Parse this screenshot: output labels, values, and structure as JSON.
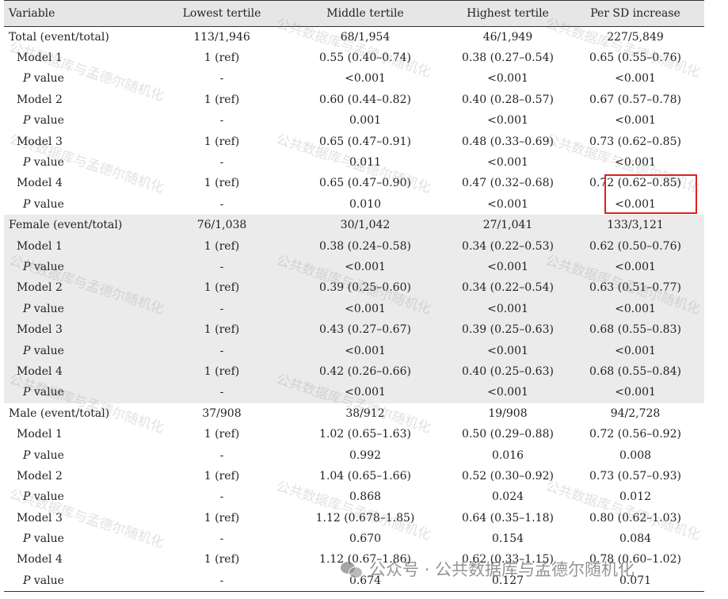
{
  "header": [
    "Variable",
    "Lowest tertile",
    "Middle tertile",
    "Highest tertile",
    "Per SD increase"
  ],
  "rows": [
    {
      "kind": "group",
      "shaded": false,
      "label": "Total (event/total)",
      "cells": [
        "113/1,946",
        "68/1,954",
        "46/1,949",
        "227/5,849"
      ]
    },
    {
      "kind": "model",
      "shaded": false,
      "label": "Model 1",
      "cells": [
        "1 (ref)",
        "0.55 (0.40–0.74)",
        "0.38 (0.27–0.54)",
        "0.65 (0.55–0.76)"
      ]
    },
    {
      "kind": "pval",
      "shaded": false,
      "p": "P",
      "label": " value",
      "cells": [
        "-",
        "<0.001",
        "<0.001",
        "<0.001"
      ]
    },
    {
      "kind": "model",
      "shaded": false,
      "label": "Model 2",
      "cells": [
        "1 (ref)",
        "0.60 (0.44–0.82)",
        "0.40 (0.28–0.57)",
        "0.67 (0.57–0.78)"
      ]
    },
    {
      "kind": "pval",
      "shaded": false,
      "p": "P",
      "label": " value",
      "cells": [
        "-",
        "0.001",
        "<0.001",
        "<0.001"
      ]
    },
    {
      "kind": "model",
      "shaded": false,
      "label": "Model 3",
      "cells": [
        "1 (ref)",
        "0.65 (0.47–0.91)",
        "0.48 (0.33–0.69)",
        "0.73 (0.62–0.85)"
      ]
    },
    {
      "kind": "pval",
      "shaded": false,
      "p": "P",
      "label": " value",
      "cells": [
        "-",
        "0.011",
        "<0.001",
        "<0.001"
      ]
    },
    {
      "kind": "model",
      "shaded": false,
      "label": "Model 4",
      "cells": [
        "1 (ref)",
        "0.65 (0.47–0.90)",
        "0.47 (0.32–0.68)",
        "0.72 (0.62–0.85)"
      ]
    },
    {
      "kind": "pval",
      "shaded": false,
      "p": "P",
      "label": " value",
      "cells": [
        "-",
        "0.010",
        "<0.001",
        "<0.001"
      ]
    },
    {
      "kind": "group",
      "shaded": true,
      "label": "Female (event/total)",
      "cells": [
        "76/1,038",
        "30/1,042",
        "27/1,041",
        "133/3,121"
      ]
    },
    {
      "kind": "model",
      "shaded": true,
      "label": "Model 1",
      "cells": [
        "1 (ref)",
        "0.38 (0.24–0.58)",
        "0.34 (0.22–0.53)",
        "0.62 (0.50–0.76)"
      ]
    },
    {
      "kind": "pval",
      "shaded": true,
      "p": "P",
      "label": " value",
      "cells": [
        "-",
        "<0.001",
        "<0.001",
        "<0.001"
      ]
    },
    {
      "kind": "model",
      "shaded": true,
      "label": "Model 2",
      "cells": [
        "1 (ref)",
        "0.39 (0.25–0.60)",
        "0.34 (0.22–0.54)",
        "0.63 (0.51–0.77)"
      ]
    },
    {
      "kind": "pval",
      "shaded": true,
      "p": "P",
      "label": " value",
      "cells": [
        "-",
        "<0.001",
        "<0.001",
        "<0.001"
      ]
    },
    {
      "kind": "model",
      "shaded": true,
      "label": "Model 3",
      "cells": [
        "1 (ref)",
        "0.43 (0.27–0.67)",
        "0.39 (0.25–0.63)",
        "0.68 (0.55–0.83)"
      ]
    },
    {
      "kind": "pval",
      "shaded": true,
      "p": "P",
      "label": " value",
      "cells": [
        "-",
        "<0.001",
        "<0.001",
        "<0.001"
      ]
    },
    {
      "kind": "model",
      "shaded": true,
      "label": "Model 4",
      "cells": [
        "1 (ref)",
        "0.42 (0.26–0.66)",
        "0.40 (0.25–0.63)",
        "0.68 (0.55–0.84)"
      ]
    },
    {
      "kind": "pval",
      "shaded": true,
      "p": "P",
      "label": " value",
      "cells": [
        "-",
        "<0.001",
        "<0.001",
        "<0.001"
      ]
    },
    {
      "kind": "group",
      "shaded": false,
      "label": "Male (event/total)",
      "cells": [
        "37/908",
        "38/912",
        "19/908",
        "94/2,728"
      ]
    },
    {
      "kind": "model",
      "shaded": false,
      "label": "Model 1",
      "cells": [
        "1 (ref)",
        "1.02 (0.65–1.63)",
        "0.50 (0.29–0.88)",
        "0.72 (0.56–0.92)"
      ]
    },
    {
      "kind": "pval",
      "shaded": false,
      "p": "P",
      "label": " value",
      "cells": [
        "-",
        "0.992",
        "0.016",
        "0.008"
      ]
    },
    {
      "kind": "model",
      "shaded": false,
      "label": "Model 2",
      "cells": [
        "1 (ref)",
        "1.04 (0.65–1.66)",
        "0.52 (0.30–0.92)",
        "0.73 (0.57–0.93)"
      ]
    },
    {
      "kind": "pval",
      "shaded": false,
      "p": "P",
      "label": " value",
      "cells": [
        "-",
        "0.868",
        "0.024",
        "0.012"
      ]
    },
    {
      "kind": "model",
      "shaded": false,
      "label": "Model 3",
      "cells": [
        "1 (ref)",
        "1.12 (0.678–1.85)",
        "0.64 (0.35–1.18)",
        "0.80 (0.62–1.03)"
      ]
    },
    {
      "kind": "pval",
      "shaded": false,
      "p": "P",
      "label": " value",
      "cells": [
        "-",
        "0.670",
        "0.154",
        "0.084"
      ]
    },
    {
      "kind": "model",
      "shaded": false,
      "label": "Model 4",
      "cells": [
        "1 (ref)",
        "1.12 (0.67–1.86)",
        "0.62 (0.33–1.15)",
        "0.78 (0.60–1.02)"
      ]
    },
    {
      "kind": "pval",
      "shaded": false,
      "p": "P",
      "label": " value",
      "cells": [
        "-",
        "0.674",
        "0.127",
        "0.071"
      ]
    }
  ],
  "highlight_color": "#e02020",
  "watermark": {
    "text": "公共数据库与孟德尔随机化",
    "footer": "公众号 · 公共数据库与孟德尔随机化",
    "icon": "wechat-icon"
  }
}
